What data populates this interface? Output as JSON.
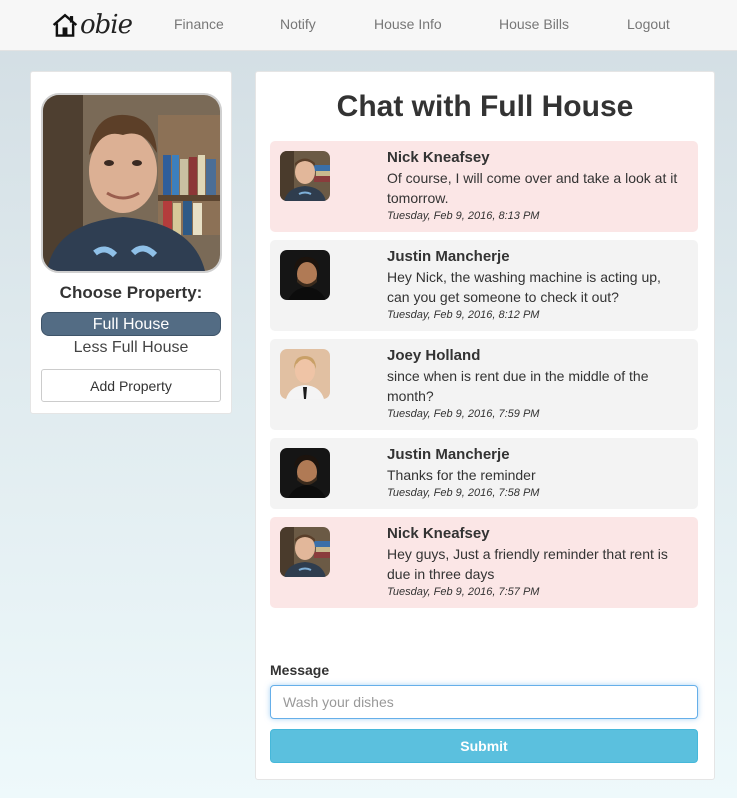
{
  "nav": {
    "brand_text": "obie",
    "links": [
      "Finance",
      "Notify",
      "House Info",
      "House Bills",
      "Logout"
    ]
  },
  "sidebar": {
    "choose_title": "Choose Property:",
    "properties": [
      "Full House",
      "Less Full House"
    ],
    "add_property_label": "Add Property"
  },
  "chat": {
    "title": "Chat with Full House",
    "messages": [
      {
        "name": "Nick Kneafsey",
        "text": "Of course, I will come over and take a look at it tomorrow.",
        "time": "Tuesday, Feb 9, 2016, 8:13 PM",
        "avatar": "nick"
      },
      {
        "name": "Justin Mancherje",
        "text": "Hey Nick, the washing machine is acting up, can you get someone to check it out?",
        "time": "Tuesday, Feb 9, 2016, 8:12 PM",
        "avatar": "justin"
      },
      {
        "name": "Joey Holland",
        "text": "since when is rent due in the middle of the month?",
        "time": "Tuesday, Feb 9, 2016, 7:59 PM",
        "avatar": "joey"
      },
      {
        "name": "Justin Mancherje",
        "text": "Thanks for the reminder",
        "time": "Tuesday, Feb 9, 2016, 7:58 PM",
        "avatar": "justin"
      },
      {
        "name": "Nick Kneafsey",
        "text": "Hey guys, Just a friendly reminder that rent is due in three days",
        "time": "Tuesday, Feb 9, 2016, 7:57 PM",
        "avatar": "nick"
      }
    ],
    "message_label": "Message",
    "message_placeholder": "Wash your dishes",
    "submit_label": "Submit"
  },
  "colors": {
    "active_property": "#536c84",
    "landlord_message_bg": "#fbe6e6",
    "tenant_message_bg": "#f3f3f3",
    "submit": "#5bc0de"
  }
}
